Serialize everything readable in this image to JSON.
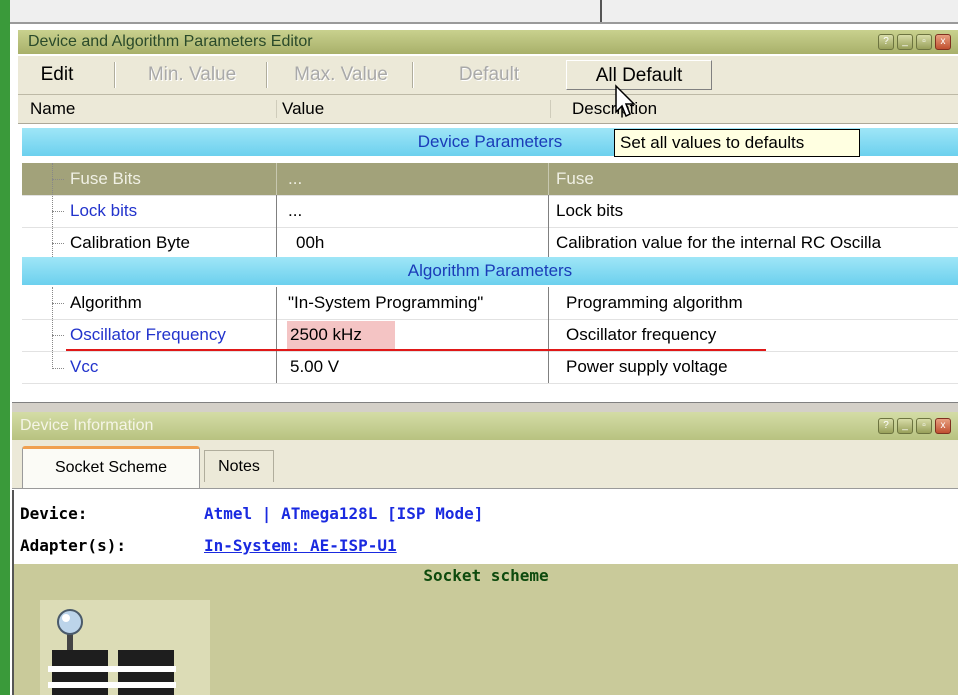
{
  "editor": {
    "title": "Device and Algorithm Parameters Editor",
    "toolbar": {
      "edit": "Edit",
      "min_value": "Min. Value",
      "max_value": "Max. Value",
      "default": "Default",
      "all_default": "All Default"
    },
    "columns": {
      "name": "Name",
      "value": "Value",
      "description": "Description"
    },
    "sections": {
      "device": "Device Parameters",
      "algorithm": "Algorithm Parameters"
    },
    "device_params": [
      {
        "name": "Fuse Bits",
        "value": "...",
        "description": "Fuse"
      },
      {
        "name": "Lock bits",
        "value": "...",
        "description": "Lock bits"
      },
      {
        "name": "Calibration Byte",
        "value": "00h",
        "description": "Calibration value for the internal RC Oscilla"
      }
    ],
    "algorithm_params": [
      {
        "name": "Algorithm",
        "value": "\"In-System Programming\"",
        "description": "Programming algorithm"
      },
      {
        "name": "Oscillator Frequency",
        "value": "2500 kHz",
        "description": "Oscillator frequency"
      },
      {
        "name": "Vcc",
        "value": "5.00 V",
        "description": "Power supply voltage"
      }
    ],
    "tooltip": "Set all values to defaults"
  },
  "info": {
    "title": "Device Information",
    "tabs": [
      "Socket Scheme",
      "Notes"
    ],
    "device_label": "Device:",
    "device_value": "Atmel |  ATmega128L   [ISP Mode]",
    "adapter_label": "Adapter(s):",
    "adapter_value": "In-System: AE-ISP-U1",
    "scheme_title": "Socket scheme"
  },
  "colors": {
    "section_bg": "#6cd0ee",
    "section_text": "#1a3bb8",
    "selected_row": "#a2a27a",
    "highlight": "#f4c4c4",
    "annotation_line": "#e01818",
    "link_blue": "#1a2ae0"
  },
  "icons": [
    "help-icon",
    "minimize-icon",
    "restore-icon",
    "close-icon",
    "arrow-cursor-icon"
  ]
}
